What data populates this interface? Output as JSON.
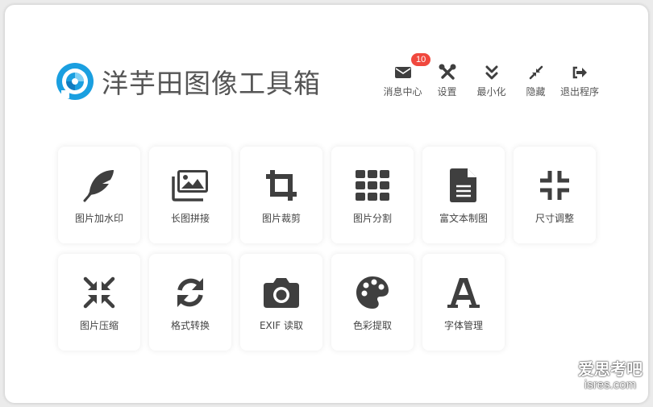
{
  "app": {
    "title": "洋芋田图像工具箱",
    "accent_color": "#1a9fe0",
    "icon_color": "#3f3f3f"
  },
  "topbar": {
    "messages": {
      "label": "消息中心",
      "badge": "10",
      "icon": "envelope-icon"
    },
    "settings": {
      "label": "设置",
      "icon": "tools-icon"
    },
    "minimize": {
      "label": "最小化",
      "icon": "double-chevron-down-icon"
    },
    "hide": {
      "label": "隐藏",
      "icon": "compress-arrows-icon"
    },
    "exit": {
      "label": "退出程序",
      "icon": "sign-out-icon"
    }
  },
  "tools": [
    {
      "label": "图片加水印",
      "icon": "feather-icon"
    },
    {
      "label": "长图拼接",
      "icon": "images-icon"
    },
    {
      "label": "图片裁剪",
      "icon": "crop-icon"
    },
    {
      "label": "图片分割",
      "icon": "grid-icon"
    },
    {
      "label": "富文本制图",
      "icon": "document-icon"
    },
    {
      "label": "尺寸调整",
      "icon": "compress-corners-icon"
    },
    {
      "label": "图片压缩",
      "icon": "compress-arrows-icon"
    },
    {
      "label": "格式转换",
      "icon": "sync-icon"
    },
    {
      "label": "EXIF 读取",
      "icon": "camera-icon"
    },
    {
      "label": "色彩提取",
      "icon": "palette-icon"
    },
    {
      "label": "字体管理",
      "icon": "font-icon"
    }
  ],
  "watermark": {
    "cn": "爱思考吧",
    "en": "isres.com"
  }
}
